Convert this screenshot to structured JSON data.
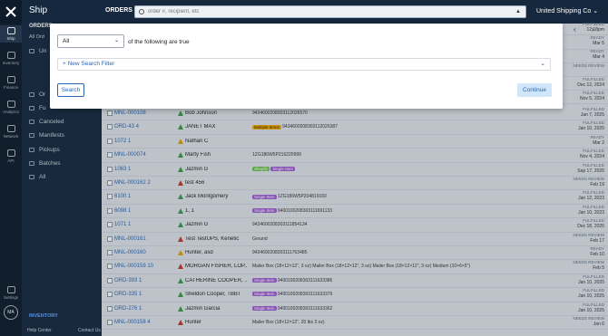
{
  "rail": {
    "items": [
      {
        "label": "Ship",
        "icon": "ship-icon",
        "active": true
      },
      {
        "label": "Inventory",
        "icon": "inventory-icon"
      },
      {
        "label": "Finance",
        "icon": "finance-icon"
      },
      {
        "label": "Analytics",
        "icon": "analytics-icon"
      },
      {
        "label": "Network",
        "icon": "network-icon"
      },
      {
        "label": "API",
        "icon": "api-icon"
      },
      {
        "label": "Settings",
        "icon": "settings-icon"
      }
    ],
    "avatar": "MA"
  },
  "nav": {
    "title": "Ship",
    "top_labels": [
      "ORDERS",
      "All Ord"
    ],
    "partial": [
      "Un",
      "Or",
      "Fu",
      "Sh",
      "An"
    ],
    "items": [
      "Canceled",
      "Manifests",
      "Pickups",
      "Batches",
      "All"
    ],
    "inventory": "INVENTORY",
    "help": "Help Center",
    "contact": "Contact Us"
  },
  "header": {
    "section": "ORDERS",
    "search_placeholder": "order #, recipient, etc",
    "company": "United Shipping Co"
  },
  "filter": {
    "match_value": "All",
    "match_suffix": "of the following are true",
    "new_filter": "+ New Search Filter",
    "search_button": "Search",
    "continue_button": "Continue"
  },
  "pager": {
    "prev": "‹",
    "next": "›"
  },
  "orders": [
    {
      "id": "MNL-000108",
      "recipient": "Bob Johnson",
      "mid": "9434600208303112026570",
      "status": "FULFILLED",
      "date": "Jan 7, 2025"
    },
    {
      "id": "ORD-43 4",
      "recipient": "JANET MAX",
      "mid": "9434600208303112026387",
      "pill": "Multiple Items",
      "pillType": "ms",
      "status": "FULFILLED",
      "date": "Jan 10, 2025"
    },
    {
      "id": "1072 1",
      "recipient": "Nathan C",
      "mid": "",
      "status": "READY",
      "date": "Mar 2"
    },
    {
      "id": "MNL-000074",
      "recipient": "Marty Fish",
      "mid": "1ZG186W5P216220999",
      "status": "FULFILLED",
      "date": "Nov 4, 2024"
    },
    {
      "id": "1063 1",
      "recipient": "Jazmin G",
      "mid": "",
      "pill": "Single Item",
      "pillType": "sh",
      "pillPrefix": "Shopify",
      "status": "FULFILLED",
      "date": "Sep 17, 2025"
    },
    {
      "id": "MNL-000162 2",
      "recipient": "test 456",
      "mid": "",
      "status": "NEEDS REVIEW",
      "date": "Feb 19"
    },
    {
      "id": "6100 1",
      "recipient": "Jack Montgomery",
      "mid": "1ZG186W5P204819160",
      "pill": "Single Item",
      "pillType": "",
      "status": "FULFILLED",
      "date": "Jan 12, 2023"
    },
    {
      "id": "6098 1",
      "recipient": "1, 1",
      "mid": "9400100208303111691133",
      "pill": "Single Item",
      "pillType": "",
      "status": "FULFILLED",
      "date": "Jan 10, 2023"
    },
    {
      "id": "1071 1",
      "recipient": "Jazmin G",
      "mid": "9434600208303111854134",
      "status": "FULFILLED",
      "date": "Dec 18, 2025"
    },
    {
      "id": "MNL-000161",
      "recipient": "Test   TestUPS, Kenetic",
      "mid": "Ground",
      "status": "NEEDS REVIEW",
      "date": "Feb 17"
    },
    {
      "id": "MNL-000160",
      "recipient": "Hunter, asd",
      "mid": "9434600208303111763485",
      "status": "READY",
      "date": "Feb 10"
    },
    {
      "id": "MNL-000159 10",
      "recipient": "MORGAN FISHER, LOP...",
      "mid": "Mailer Box (18×12×12\", 3 oz)  Mailer Box (18×12×12\", 3 oz)  Mailer Box (18×12×12\", 3 oz)  Medium (10×6×5\")",
      "status": "NEEDS REVIEW",
      "date": "Feb 5"
    },
    {
      "id": "ORD-393 1",
      "recipient": "CATHERINE COOPER, ...",
      "mid": "9400100208303111633386",
      "pill": "Single Item",
      "pillType": "",
      "status": "FULFILLED",
      "date": "Jan 10, 2025"
    },
    {
      "id": "ORD-335 1",
      "recipient": "Sheldon Cooper, TBBT",
      "mid": "9400100208303111633379",
      "pill": "Single Item",
      "pillType": "",
      "status": "FULFILLED",
      "date": "Jan 10, 2025"
    },
    {
      "id": "ORD-276 1",
      "recipient": "Jazmin Garcia",
      "mid": "9400100208303111633362",
      "pill": "Single Item",
      "pillType": "",
      "status": "FULFILLED",
      "date": "Jan 10, 2025"
    },
    {
      "id": "MNL-000158 4",
      "recipient": "Hunter",
      "mid": "Mailer Box (18×12×12\", 20 lbs 3 oz)",
      "status": "NEEDS REVIEW",
      "date": "Jan 6"
    }
  ],
  "above_dates": [
    {
      "status": "FULFILLED",
      "date": "12:18pm"
    },
    {
      "status": "READY",
      "date": "Mar 5"
    },
    {
      "status": "READY",
      "date": "Mar 4"
    },
    {
      "status": "NEEDS REVIEW",
      "date": ""
    },
    {
      "status": "FULFILLED",
      "date": "Dec 12, 2024"
    },
    {
      "status": "FULFILLED",
      "date": "Nov 5, 2024"
    }
  ],
  "colors": {
    "rail": "#0d1b2a",
    "nav": "#16283d",
    "link": "#2a67b0",
    "accent": "#5ea7ff"
  }
}
